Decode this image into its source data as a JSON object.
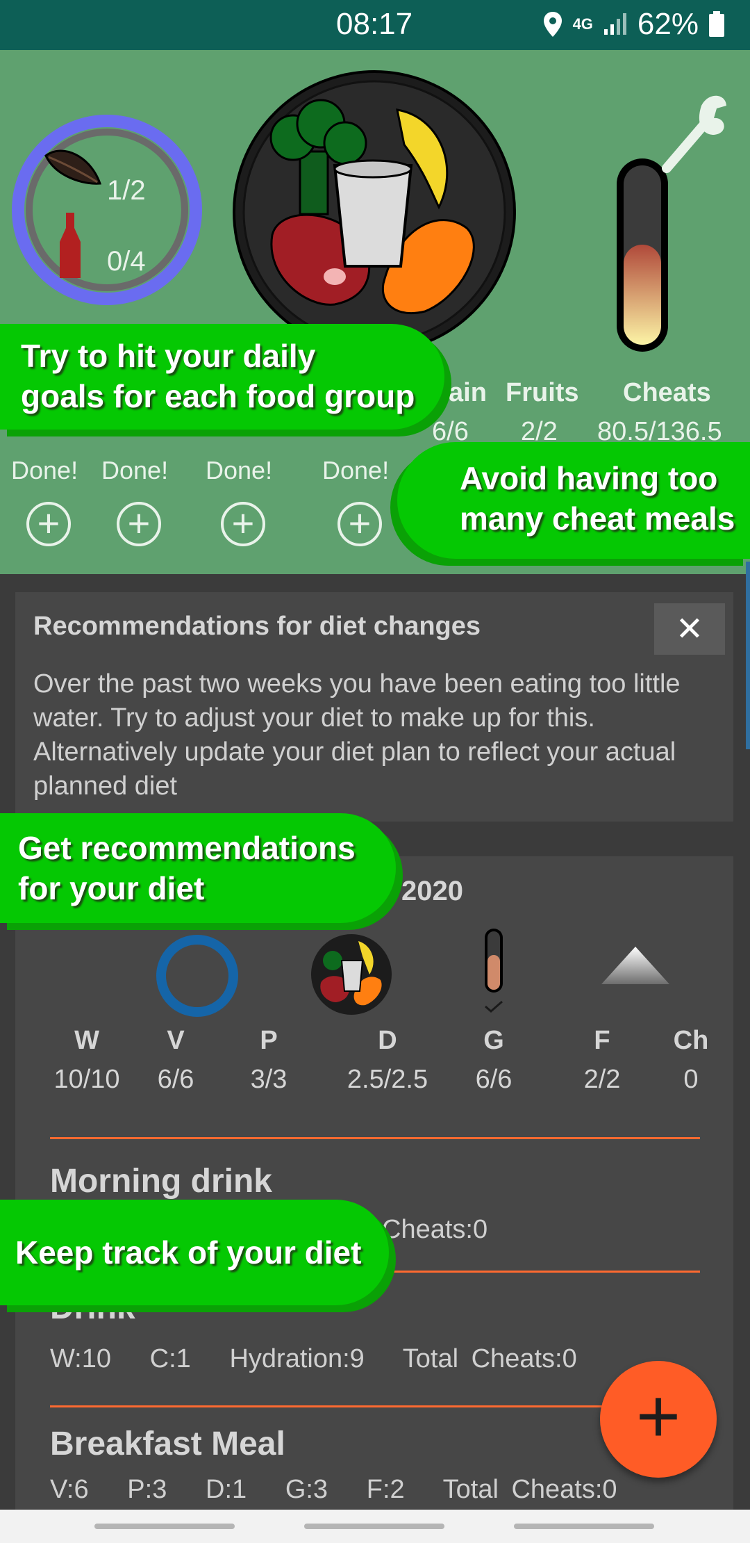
{
  "status_bar": {
    "time": "08:17",
    "network": "4G",
    "battery": "62%"
  },
  "top_panel": {
    "ring": {
      "top_value": "1/2",
      "bottom_value": "0/4"
    },
    "columns": [
      {
        "header": "ain",
        "value": "6/6"
      },
      {
        "header": "Fruits",
        "value": "2/2"
      },
      {
        "header": "Cheats",
        "value": "80.5/136.5"
      }
    ],
    "done_labels": [
      "Done!",
      "Done!",
      "Done!",
      "Done!"
    ]
  },
  "callouts": {
    "goals": [
      "Try to hit your daily",
      "goals for each food group"
    ],
    "cheats": [
      "Avoid having too",
      "many cheat meals"
    ],
    "recommend": [
      "Get recommendations",
      "for your diet"
    ],
    "track": "Keep track of your diet"
  },
  "recommendation_card": {
    "title": "Recommendations for diet changes",
    "close": "✕",
    "body": "Over the past two weeks you have been eating too little water. Try to adjust your diet to make up for this. Alternatively update your diet plan to reflect your actual planned diet"
  },
  "day_card": {
    "date_fragment": "2020",
    "summary": [
      {
        "letter": "W",
        "value": "10/10"
      },
      {
        "letter": "V",
        "value": "6/6"
      },
      {
        "letter": "P",
        "value": "3/3"
      },
      {
        "letter": "D",
        "value": "2.5/2.5"
      },
      {
        "letter": "G",
        "value": "6/6"
      },
      {
        "letter": "F",
        "value": "2/2"
      },
      {
        "letter": "Ch",
        "value": "0"
      }
    ],
    "meals": [
      {
        "title": "Morning drink",
        "details": "Cheats:0"
      },
      {
        "title": "Drink",
        "details": "W:10   C:1   Hydration:9   Total Cheats:0"
      },
      {
        "title": "Breakfast Meal",
        "details": "V:6   P:3   D:1   G:3   F:2   Total Cheats:0"
      }
    ]
  },
  "fab": {
    "label": "+"
  },
  "colors": {
    "top_green": "#5fa16f",
    "callout_green": "#05c803",
    "accent_orange": "#ff5c26",
    "ring_blue": "#6a6cf0"
  }
}
